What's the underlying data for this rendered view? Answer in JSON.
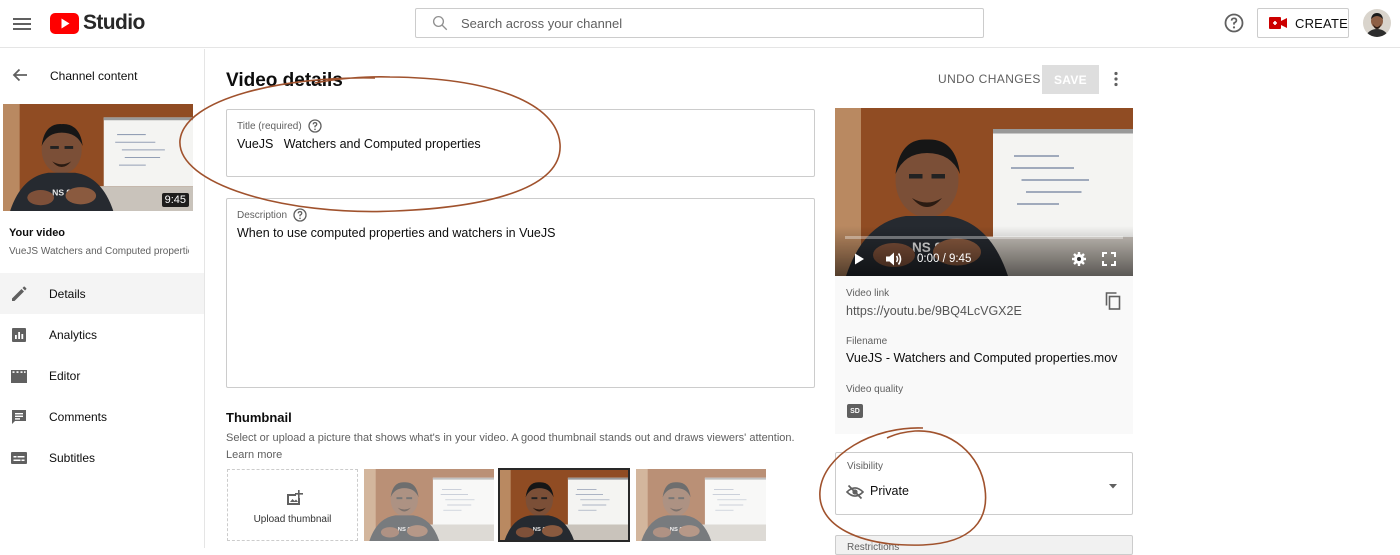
{
  "app": {
    "logo_text": "Studio"
  },
  "search": {
    "placeholder": "Search across your channel"
  },
  "header": {
    "create_label": "CREATE"
  },
  "sidebar": {
    "back_label": "Channel content",
    "video_duration": "9:45",
    "your_video_label": "Your video",
    "video_title": "VueJS Watchers and Computed properties",
    "items": [
      {
        "label": "Details",
        "icon": "pencil-icon",
        "active": true
      },
      {
        "label": "Analytics",
        "icon": "analytics-icon",
        "active": false
      },
      {
        "label": "Editor",
        "icon": "editor-icon",
        "active": false
      },
      {
        "label": "Comments",
        "icon": "comments-icon",
        "active": false
      },
      {
        "label": "Subtitles",
        "icon": "subtitles-icon",
        "active": false
      }
    ]
  },
  "main": {
    "page_title": "Video details",
    "undo_label": "UNDO CHANGES",
    "save_label": "SAVE",
    "title_field": {
      "label": "Title (required)",
      "value": "VueJS   Watchers and Computed properties"
    },
    "description_field": {
      "label": "Description",
      "value": "When to use computed properties and watchers in VueJS"
    },
    "thumbnail": {
      "heading": "Thumbnail",
      "description": "Select or upload a picture that shows what's in your video. A good thumbnail stands out and draws viewers' attention.",
      "learn_more": "Learn more",
      "upload_label": "Upload thumbnail",
      "selected_index": 1
    }
  },
  "preview": {
    "time": "0:00 / 9:45",
    "video_link_label": "Video link",
    "video_link": "https://youtu.be/9BQ4LcVGX2E",
    "filename_label": "Filename",
    "filename": "VueJS - Watchers and Computed properties.mov",
    "video_quality_label": "Video quality",
    "quality_badge": "SD"
  },
  "visibility": {
    "label": "Visibility",
    "value": "Private"
  },
  "restrictions": {
    "label": "Restrictions"
  },
  "colors": {
    "brand_red": "#ff0000",
    "annotation": "#a0522d",
    "text": "#0d0d0d",
    "muted": "#606060"
  }
}
